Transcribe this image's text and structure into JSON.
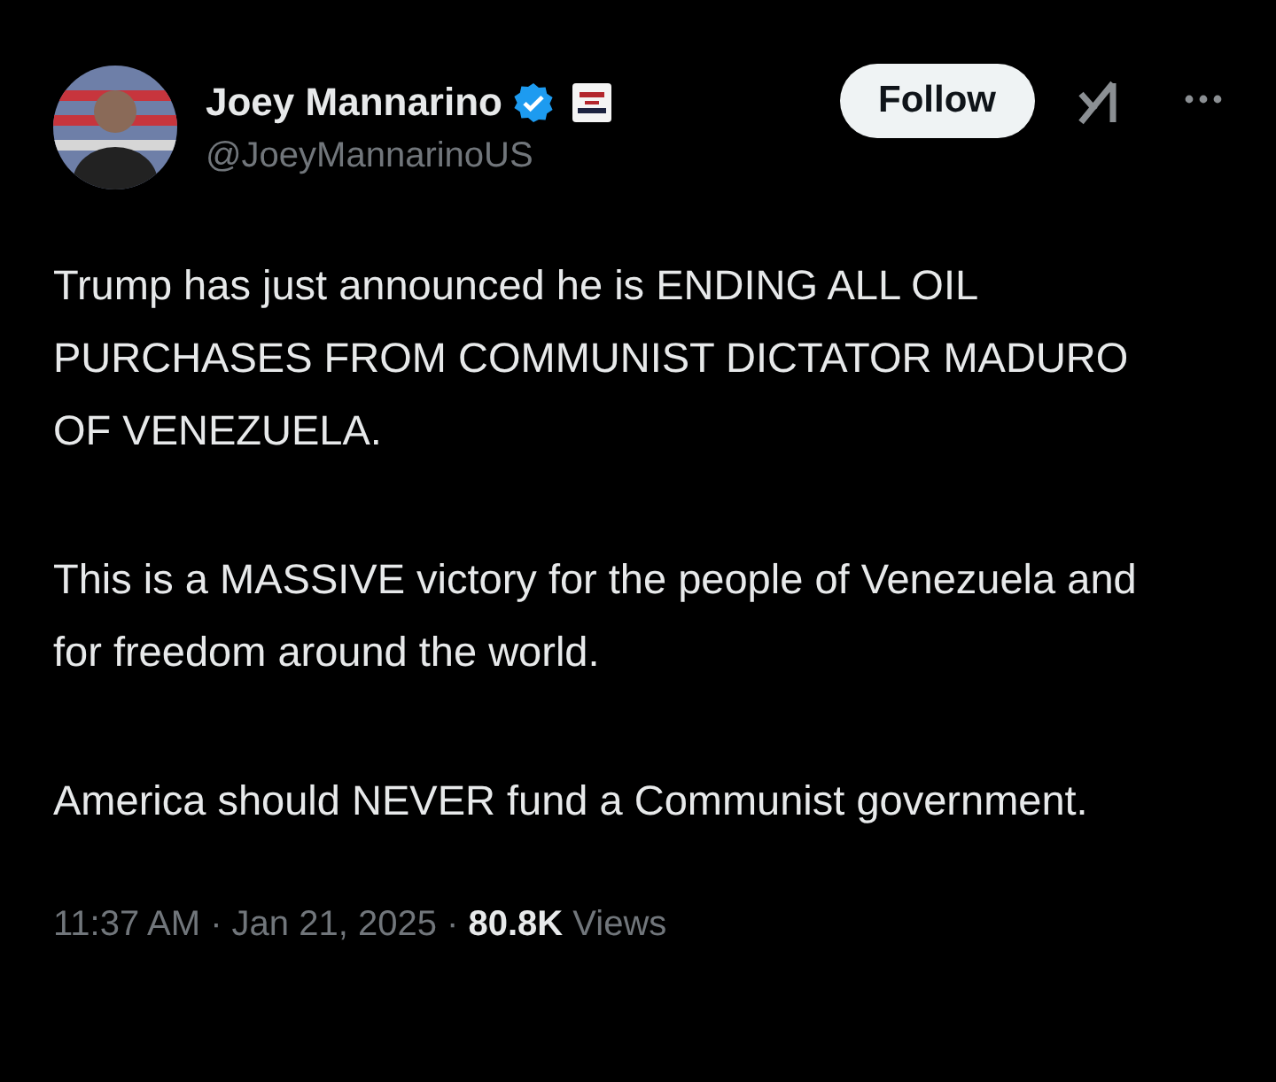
{
  "author": {
    "name": "Joey Mannarino",
    "verified": true,
    "handle": "@JoeyMannarinoUS"
  },
  "follow_button": {
    "label": "Follow"
  },
  "paragraphs": [
    "Trump has just announced he is ENDING ALL OIL PURCHASES FROM COMMUNIST DICTATOR MADURO OF VENEZUELA.",
    "This is a MASSIVE victory for the people of Venezuela and for freedom around the world.",
    "America should NEVER fund a Communist government."
  ],
  "meta": "11:37 AM · Jan 21, 2025 · **80.8K** Views"
}
